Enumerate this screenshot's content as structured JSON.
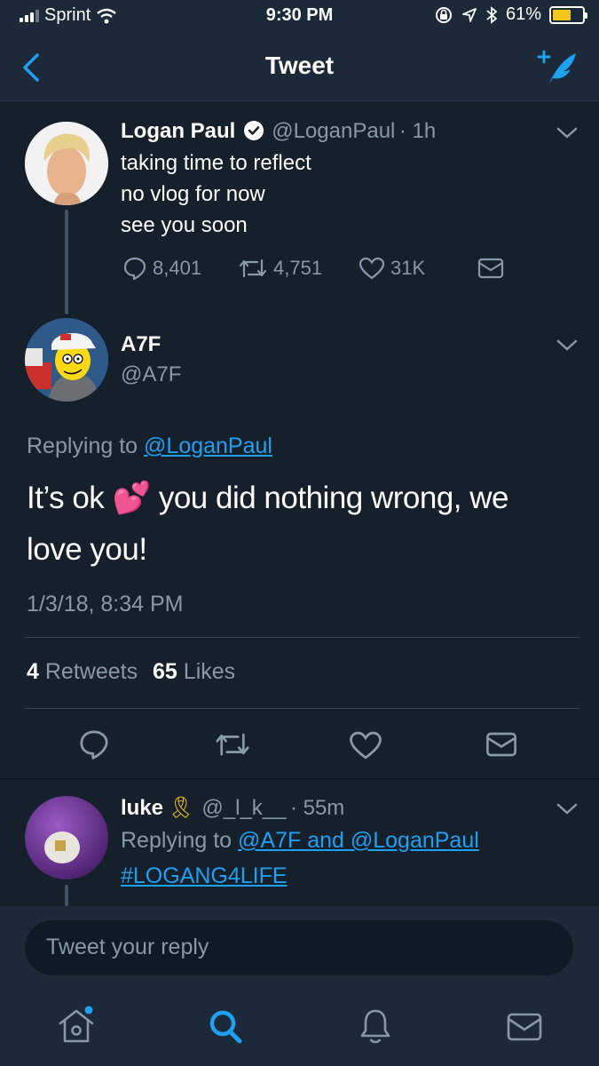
{
  "status_bar": {
    "carrier": "Sprint",
    "time": "9:30 PM",
    "battery": "61%",
    "battery_fraction": 0.61
  },
  "nav": {
    "title": "Tweet",
    "back_icon": "chevron-left-icon",
    "compose_icon": "compose-tweet-icon"
  },
  "original_tweet": {
    "name": "Logan Paul",
    "handle": "@LoganPaul",
    "time": "· 1h",
    "lines": [
      "taking time to reflect",
      "no vlog for now",
      "see you soon"
    ],
    "replies": "8,401",
    "retweets": "4,751",
    "likes": "31K"
  },
  "focused_tweet": {
    "name": "A7F",
    "handle": "@A7F",
    "replying_prefix": "Replying to",
    "replying_to": "@LoganPaul",
    "text_before_emoji": "It’s ok",
    "emoji": "💕",
    "text_after_emoji": "you did nothing wrong, we",
    "text_line2": "love you!",
    "timestamp": "1/3/18, 8:34 PM",
    "retweet_count": "4",
    "retweet_label": "Retweets",
    "like_count": "65",
    "like_label": "Likes"
  },
  "reply_tweet": {
    "name": "luke",
    "badge_emoji": "🎗",
    "handle": "@_l_k__",
    "time": "· 55m",
    "replying_prefix": "Replying to",
    "replying_to": "@A7F and @LoganPaul",
    "text": "#LOGANG4LIFE"
  },
  "reply_box": {
    "placeholder": "Tweet your reply"
  },
  "tabs": [
    "home-icon",
    "search-icon",
    "notifications-icon",
    "messages-icon"
  ],
  "colors": {
    "background": "#15202b",
    "bars": "#1b2938",
    "accent": "#1da1f2",
    "muted": "#8899a6"
  }
}
